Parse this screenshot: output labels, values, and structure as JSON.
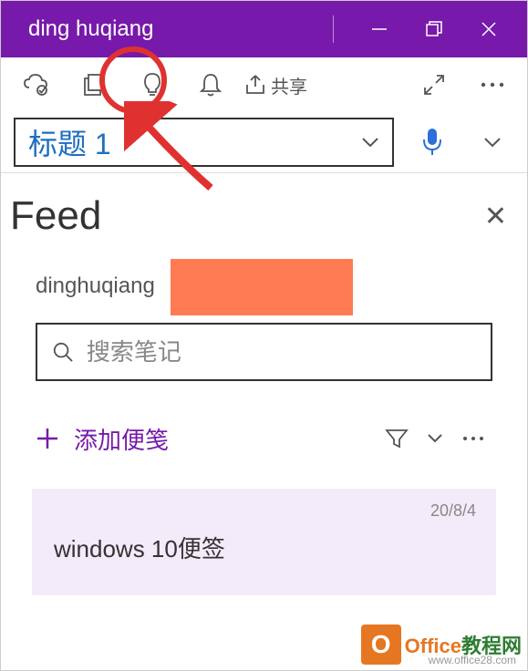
{
  "titlebar": {
    "title": "ding huqiang"
  },
  "toolbar": {
    "share_label": "共享"
  },
  "stylebar": {
    "heading_label": "标题 1"
  },
  "feed": {
    "title": "Feed",
    "user_name": "dinghuqiang",
    "search_placeholder": "搜索笔记",
    "add_note_label": "添加便笺"
  },
  "note": {
    "date": "20/8/4",
    "title": "windows 10便签"
  },
  "watermark": {
    "brand_office": "Office",
    "brand_rest": "教程网",
    "sub": "www.office28.com"
  }
}
